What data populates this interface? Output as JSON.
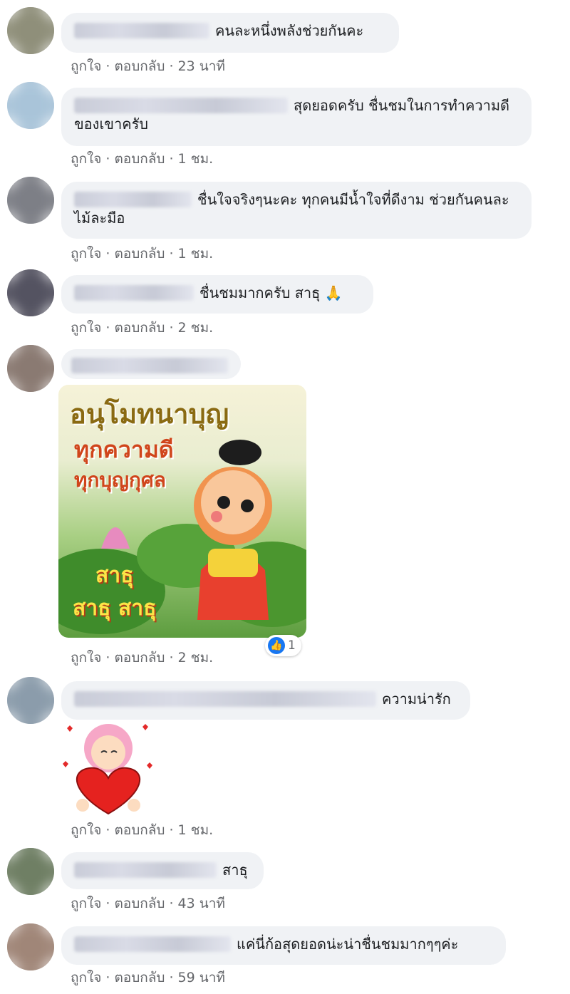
{
  "actions": {
    "like": "ถูกใจ",
    "reply": "ตอบกลับ",
    "separator": "·"
  },
  "comments": [
    {
      "text": "คนละหนึ่งพลังช่วยกันคะ",
      "time": "23 นาที",
      "avatar_color": "#8f8f7a"
    },
    {
      "text": "สุดยอดครับ ชื่นชมในการทำความดีของเขาครับ",
      "time": "1 ชม.",
      "avatar_color": "#a9c4d9"
    },
    {
      "text": "ชื่นใจจริงๆนะคะ ทุกคนมีน้ำใจที่ดีงาม ช่วยกันคนละไม้ละมือ",
      "time": "1 ชม.",
      "avatar_color": "#7d7f86"
    },
    {
      "text": "ชื่นชมมากครับ สาธุ 🙏",
      "time": "2 ชม.",
      "avatar_color": "#545361"
    },
    {
      "text": "",
      "time": "2 ชม.",
      "avatar_color": "#8a7a72"
    },
    {
      "text": "ความน่ารัก",
      "time": "1 ชม.",
      "avatar_color": "#8b9cab"
    },
    {
      "text": "สาธุ",
      "time": "43 นาที",
      "avatar_color": "#6f7f64"
    },
    {
      "text": "แค่นี่ก้อสุดยอดน่ะน่าชื่นชมมากๆๆค่ะ",
      "time": "59 นาที",
      "avatar_color": "#a08678"
    }
  ],
  "image_comment": {
    "line1": "อนุโมทนาบุญ",
    "line2": "ทุกความดี",
    "line3": "ทุกบุญกุศล",
    "line4": "สาธุ",
    "line5": "สาธุ สาธุ",
    "reaction_count": "1",
    "reaction_icon": "like-thumb-icon"
  },
  "colors": {
    "bubble": "#f0f2f5",
    "meta": "#65676b",
    "like_blue": "#1877f2"
  }
}
